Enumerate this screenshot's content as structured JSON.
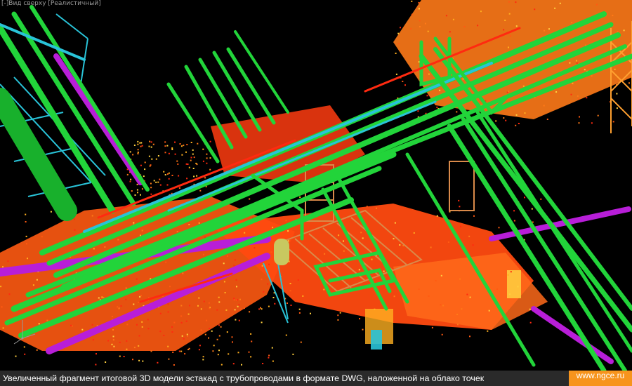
{
  "viewport": {
    "view_label": "[-]Вид сверху [Реалистичный]"
  },
  "scene": {
    "colors": {
      "pipe_green": "#22d43a",
      "pipe_green_dark": "#0f7a1e",
      "pipe_cyan": "#29c3d8",
      "pipe_magenta": "#b81ed8",
      "pointcloud_orange": "#ff5a12",
      "pointcloud_yellow": "#ffb020",
      "steel_tan": "#d98a4a",
      "background": "#000000"
    },
    "icons": [
      "ucs-axis-icon"
    ]
  },
  "caption": {
    "text": "Увеличенный фрагмент итоговой 3D модели эстакад с трубопроводами в формате DWG, наложенной на облако точек",
    "site": "www.ngce.ru",
    "colors": {
      "bar": "#2a2a2a",
      "accent": "#f7941d",
      "text": "#ffffff"
    }
  }
}
